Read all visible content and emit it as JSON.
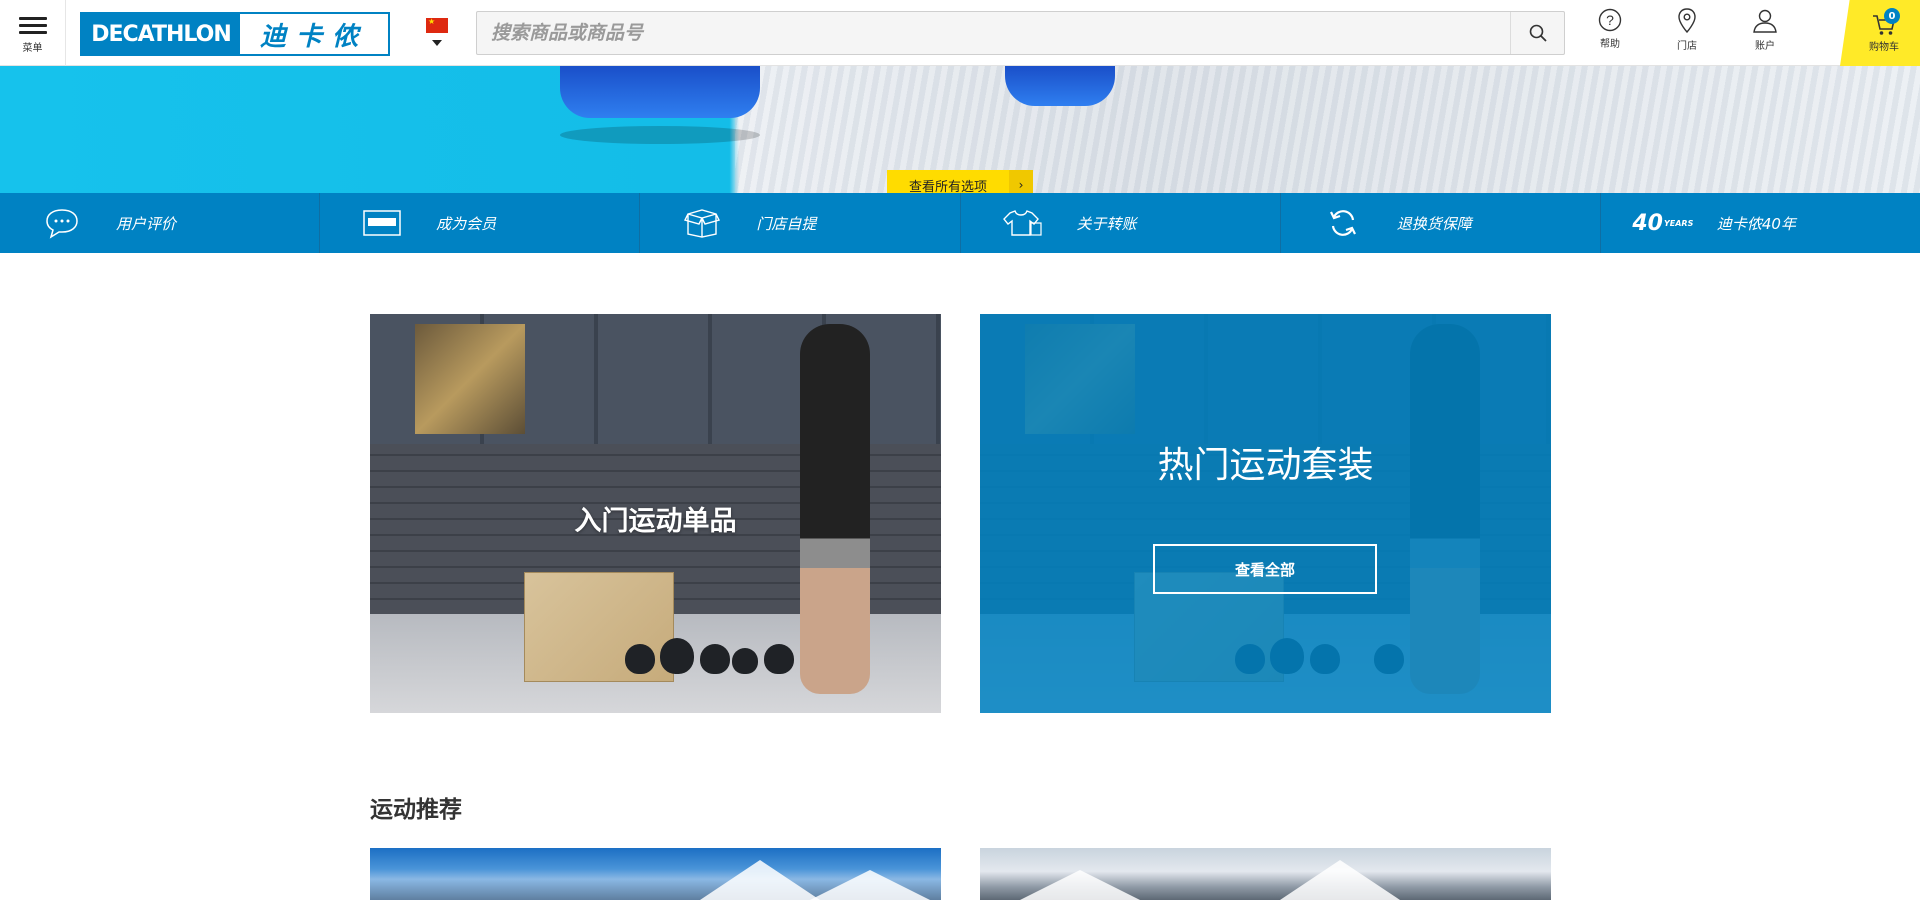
{
  "header": {
    "menu_label": "菜单",
    "logo_en": "DECATHLON",
    "logo_cn": "迪卡侬",
    "search_placeholder": "搜索商品或商品号",
    "help_label": "帮助",
    "store_label": "门店",
    "account_label": "账户",
    "cart_label": "购物车",
    "cart_count": "0"
  },
  "hero": {
    "cta_label": "查看所有选项",
    "slides": 3,
    "active_slide": 3
  },
  "service_bar": {
    "items": [
      {
        "label": "用户评价",
        "icon": "chat-bubble-icon"
      },
      {
        "label": "成为会员",
        "icon": "member-card-icon"
      },
      {
        "label": "门店自提",
        "icon": "box-icon"
      },
      {
        "label": "关于转账",
        "icon": "shirt-icon"
      },
      {
        "label": "退换货保障",
        "icon": "refresh-icon"
      },
      {
        "label": "迪卡侬40年",
        "icon": "40-years-icon"
      }
    ],
    "years_badge": "40",
    "years_sub": "YEARS"
  },
  "promos": {
    "left_title": "入门运动单品",
    "right_title": "热门运动套装",
    "right_button": "查看全部"
  },
  "recommend": {
    "title": "运动推荐"
  },
  "colors": {
    "brand_blue": "#0082c3",
    "cart_yellow": "#ffea28",
    "cta_yellow": "#ffdc00"
  }
}
